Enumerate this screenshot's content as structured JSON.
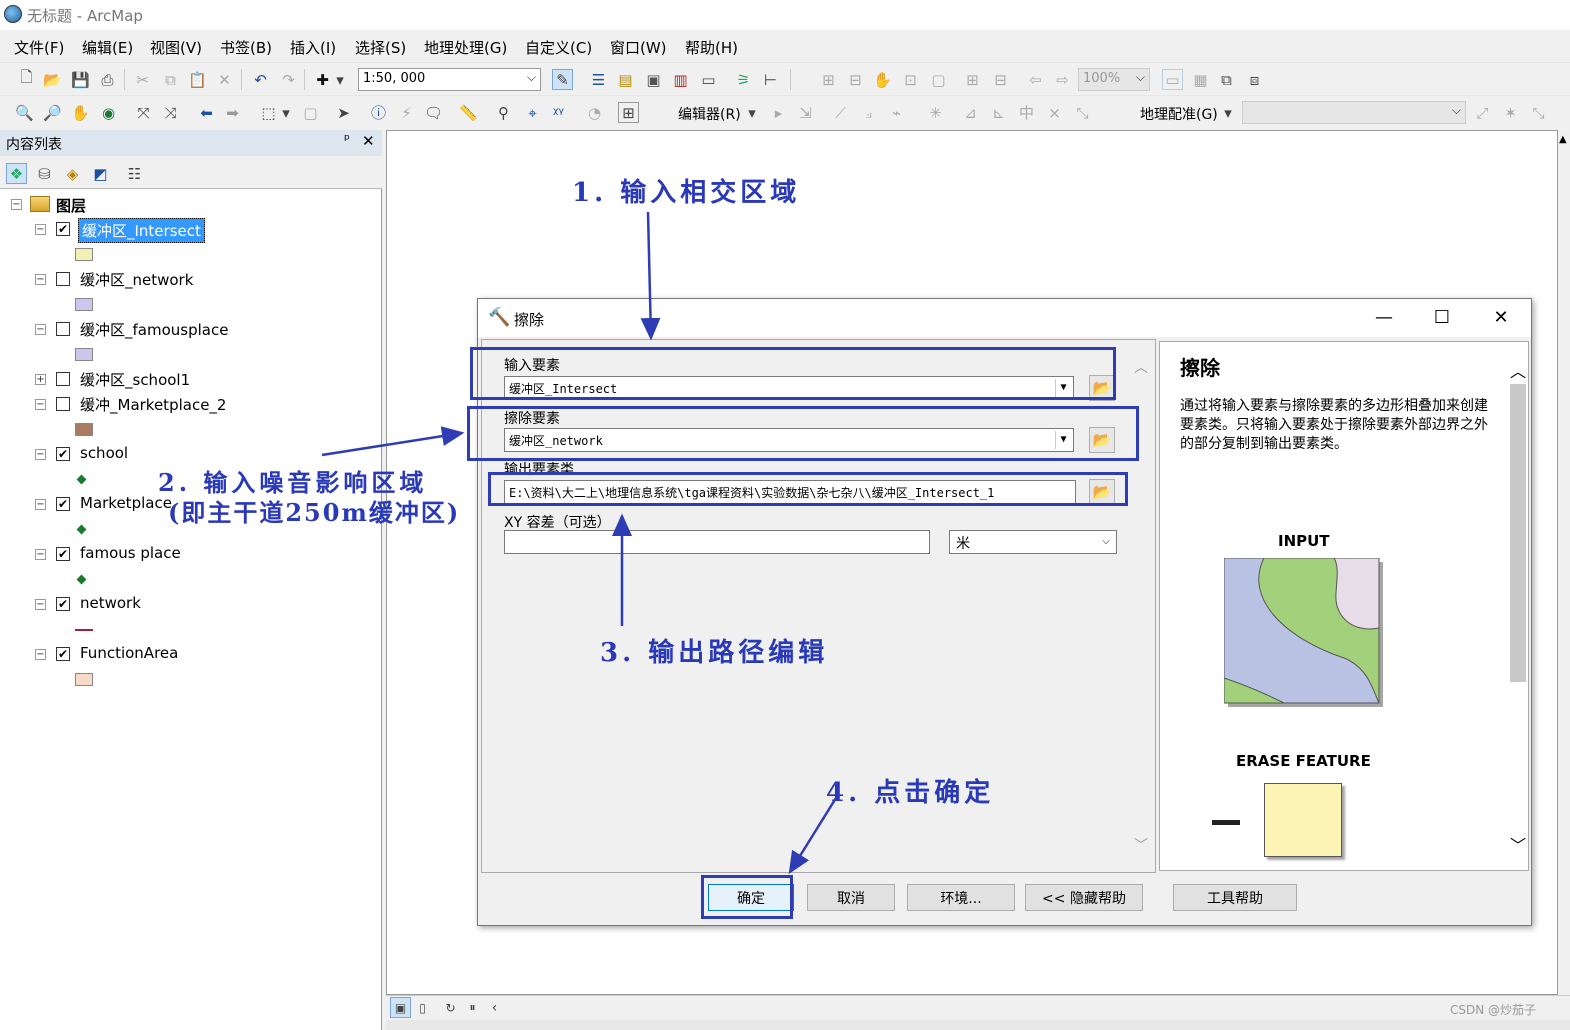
{
  "window": {
    "title": "无标题 - ArcMap"
  },
  "menu": [
    "文件(F)",
    "编辑(E)",
    "视图(V)",
    "书签(B)",
    "插入(I)",
    "选择(S)",
    "地理处理(G)",
    "自定义(C)",
    "窗口(W)",
    "帮助(H)"
  ],
  "toolbar": {
    "scale": "1:50, 000",
    "zoom_percent": "100%",
    "editor_label": "编辑器(R)",
    "georef_label": "地理配准(G)"
  },
  "toc": {
    "title": "内容列表",
    "pin": "ᵖ",
    "close": "✕",
    "root": "图层",
    "layers": [
      {
        "name": "缓冲区_Intersect",
        "checked": true,
        "selected": true,
        "swatch_color": "#f3f0b3",
        "kind": "polygon",
        "expander": "⊟"
      },
      {
        "name": "缓冲区_network",
        "checked": false,
        "swatch_color": "#cfc6ef",
        "kind": "polygon",
        "expander": "⊟"
      },
      {
        "name": "缓冲区_famousplace",
        "checked": false,
        "swatch_color": "#cfc6ef",
        "kind": "polygon",
        "expander": "⊟"
      },
      {
        "name": "缓冲区_school1",
        "checked": false,
        "kind": "none",
        "expander": "⊞"
      },
      {
        "name": "缓冲_Marketplace_2",
        "checked": false,
        "swatch_color": "#a97b63",
        "kind": "polygon",
        "expander": "⊟"
      },
      {
        "name": "school",
        "checked": true,
        "kind": "point",
        "expander": "⊟"
      },
      {
        "name": "Marketplace",
        "checked": true,
        "kind": "point",
        "expander": "⊟"
      },
      {
        "name": "famous place",
        "checked": true,
        "kind": "point",
        "expander": "⊟"
      },
      {
        "name": "network",
        "checked": true,
        "kind": "line",
        "line_color": "#a02040",
        "expander": "⊟"
      },
      {
        "name": "FunctionArea",
        "checked": true,
        "swatch_color": "#f7d9c7",
        "kind": "polygon",
        "expander": "⊟"
      }
    ]
  },
  "dialog": {
    "title": "擦除",
    "input_label": "输入要素",
    "input_value": "缓冲区_Intersect",
    "erase_label": "擦除要素",
    "erase_value": "缓冲区_network",
    "output_label": "输出要素类",
    "output_value": "E:\\资料\\大二上\\地理信息系统\\tga课程资料\\实验数据\\杂七杂八\\缓冲区_Intersect_1",
    "xy_label": "XY 容差（可选）",
    "xy_value": "",
    "unit_value": "米",
    "buttons": {
      "ok": "确定",
      "cancel": "取消",
      "env": "环境...",
      "hide_help": "<< 隐藏帮助",
      "tool_help": "工具帮助"
    },
    "help": {
      "title": "擦除",
      "description": "通过将输入要素与擦除要素的多边形相叠加来创建要素类。只将输入要素处于擦除要素外部边界之外的部分复制到输出要素类。",
      "input_caption": "INPUT",
      "erase_caption": "ERASE FEATURE"
    }
  },
  "annotations": {
    "step1": "1. 输入相交区域",
    "step2_line1": "2. 输入噪音影响区域",
    "step2_line2": "(即主干道250m缓冲区)",
    "step3": "3. 输出路径编辑",
    "step4": "4. 点击确定",
    "color": "#2f3db5"
  },
  "watermark": "CSDN @炒茄子"
}
